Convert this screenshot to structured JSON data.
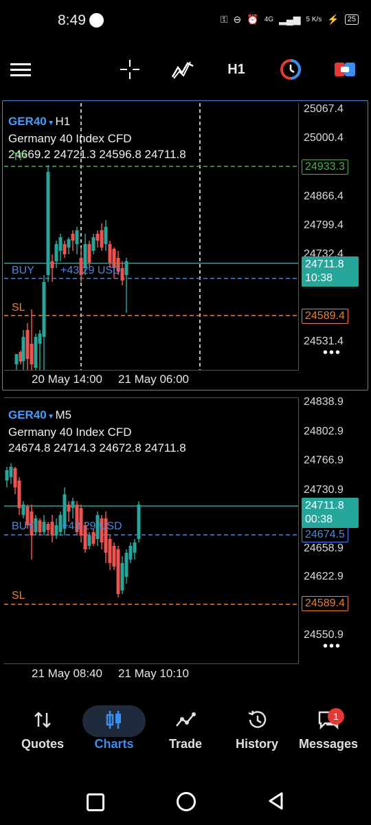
{
  "status_bar": {
    "time": "8:49",
    "network": "4G",
    "speed": "5 K/s",
    "battery": "25"
  },
  "toolbar": {
    "timeframe": "H1"
  },
  "chart_top": {
    "symbol": "GER40",
    "timeframe": "H1",
    "name": "Germany 40 Index CFD",
    "ohlc": "24669.2 24721.3 24596.8 24711.8",
    "tp_label": "TP",
    "buy_label": "BUY",
    "profit": "+43.29 USD",
    "sl_label": "SL",
    "prices": [
      "25067.4",
      "25000.4",
      "24866.4",
      "24799.4",
      "24732.4",
      "24531.4"
    ],
    "tp_value": "24933.3",
    "current_price": "24711.8",
    "current_time": "10:38",
    "sl_value": "24589.4",
    "time_labels": [
      "20 May 14:00",
      "21 May 06:00"
    ],
    "more": "•••"
  },
  "chart_bottom": {
    "symbol": "GER40",
    "timeframe": "M5",
    "name": "Germany 40 Index CFD",
    "ohlc": "24674.8 24714.3 24672.8 24711.8",
    "buy_label": "BUY",
    "profit": "+43.29 USD",
    "sl_label": "SL",
    "prices": [
      "24838.9",
      "24802.9",
      "24766.9",
      "24730.9",
      "24658.9",
      "24622.9",
      "24550.9"
    ],
    "current_price": "24711.8",
    "current_time": "00:38",
    "entry_value": "24674.5",
    "sl_value": "24589.4",
    "time_labels": [
      "21 May 08:40",
      "21 May 10:10"
    ],
    "more": "•••"
  },
  "colors": {
    "up": "#26a69a",
    "down": "#ef5350",
    "tp": "#4caf50",
    "sl": "#f57c28",
    "entry": "#4a86e8",
    "accent": "#3b8ef0"
  },
  "nav": [
    {
      "label": "Quotes",
      "icon": "quotes-icon"
    },
    {
      "label": "Charts",
      "icon": "charts-icon"
    },
    {
      "label": "Trade",
      "icon": "trade-icon"
    },
    {
      "label": "History",
      "icon": "history-icon"
    },
    {
      "label": "Messages",
      "icon": "messages-icon"
    }
  ],
  "messages_badge": "1"
}
